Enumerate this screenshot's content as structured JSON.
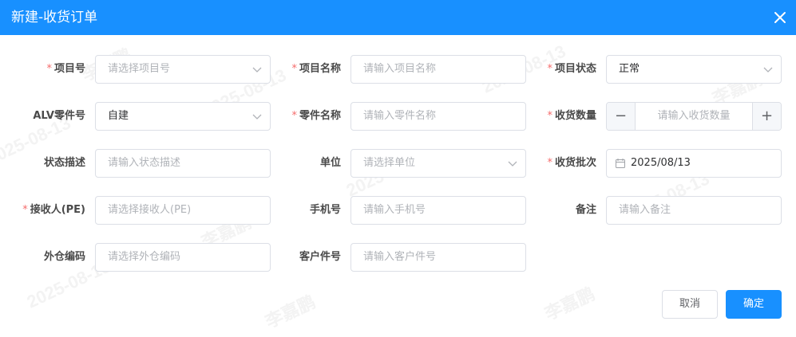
{
  "dialog": {
    "title": "新建-收货订单",
    "close_icon": "close-icon"
  },
  "watermark": {
    "name": "李嘉鹏",
    "date": "2025-08-13"
  },
  "form": {
    "project_no": {
      "label": "项目号",
      "required": true,
      "placeholder": "请选择项目号"
    },
    "project_name": {
      "label": "项目名称",
      "required": true,
      "placeholder": "请输入项目名称"
    },
    "project_status": {
      "label": "项目状态",
      "required": true,
      "value": "正常"
    },
    "alv_part_no": {
      "label": "ALV零件号",
      "required": false,
      "value": "自建"
    },
    "part_name": {
      "label": "零件名称",
      "required": true,
      "placeholder": "请输入零件名称"
    },
    "receive_qty": {
      "label": "收货数量",
      "required": true,
      "placeholder": "请输入收货数量",
      "minus": "−",
      "plus": "+"
    },
    "status_desc": {
      "label": "状态描述",
      "required": false,
      "placeholder": "请输入状态描述"
    },
    "unit": {
      "label": "单位",
      "required": false,
      "placeholder": "请选择单位"
    },
    "receive_batch": {
      "label": "收货批次",
      "required": true,
      "value": "2025/08/13"
    },
    "receiver": {
      "label": "接收人(PE)",
      "required": true,
      "placeholder": "请选择接收人(PE)"
    },
    "phone": {
      "label": "手机号",
      "required": false,
      "placeholder": "请输入手机号"
    },
    "remark": {
      "label": "备注",
      "required": false,
      "placeholder": "请输入备注"
    },
    "outside_warehouse": {
      "label": "外仓编码",
      "required": false,
      "placeholder": "请选择外仓编码"
    },
    "customer_part_no": {
      "label": "客户件号",
      "required": false,
      "placeholder": "请输入客户件号"
    }
  },
  "footer": {
    "cancel_label": "取消",
    "confirm_label": "确定"
  },
  "colors": {
    "primary": "#1890ff",
    "required": "#f56c6c"
  }
}
